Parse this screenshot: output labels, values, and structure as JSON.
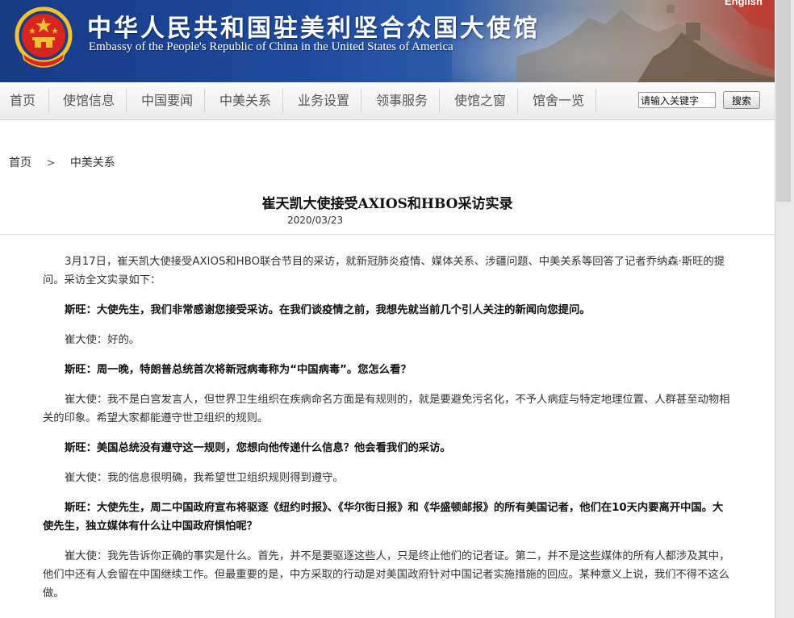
{
  "header": {
    "title_zh": "中华人民共和国驻美利坚合众国大使馆",
    "title_en": "Embassy of the People's Republic of China in the United States of America",
    "english_link": "English",
    "colors": {
      "banner_blue": "#1f4a9c",
      "emblem_red": "#d8261f",
      "emblem_gold": "#f2c230"
    }
  },
  "nav": {
    "items": [
      "首页",
      "使馆信息",
      "中国要闻",
      "中美关系",
      "业务设置",
      "领事服务",
      "使馆之窗",
      "馆舍一览"
    ]
  },
  "search": {
    "value": "请输入关键字",
    "button_label": "搜索"
  },
  "breadcrumb": {
    "items": [
      "首页",
      "中美关系"
    ]
  },
  "article": {
    "title": "崔天凯大使接受AXIOS和HBO采访实录",
    "date": "2020/03/23",
    "paragraphs": [
      {
        "bold": false,
        "text": "3月17日，崔天凯大使接受AXIOS和HBO联合节目的采访，就新冠肺炎疫情、媒体关系、涉疆问题、中美关系等回答了记者乔纳森·斯旺的提问。采访全文实录如下："
      },
      {
        "bold": true,
        "text": "斯旺：大使先生，我们非常感谢您接受采访。在我们谈疫情之前，我想先就当前几个引人关注的新闻向您提问。"
      },
      {
        "bold": false,
        "text": "崔大使：好的。"
      },
      {
        "bold": true,
        "text": "斯旺：周一晚，特朗普总统首次将新冠病毒称为“中国病毒”。您怎么看？"
      },
      {
        "bold": false,
        "text": "崔大使：我不是白宫发言人，但世界卫生组织在疾病命名方面是有规则的，就是要避免污名化，不予人病症与特定地理位置、人群甚至动物相关的印象。希望大家都能遵守世卫组织的规则。"
      },
      {
        "bold": true,
        "text": "斯旺：美国总统没有遵守这一规则，您想向他传递什么信息？他会看我们的采访。"
      },
      {
        "bold": false,
        "text": "崔大使：我的信息很明确，我希望世卫组织规则得到遵守。"
      },
      {
        "bold": true,
        "text": "斯旺：大使先生，周二中国政府宣布将驱逐《纽约时报》、《华尔街日报》和《华盛顿邮报》的所有美国记者，他们在10天内要离开中国。大使先生，独立媒体有什么让中国政府惧怕呢？"
      },
      {
        "bold": false,
        "text": "崔大使：我先告诉你正确的事实是什么。首先，并不是要驱逐这些人，只是终止他们的记者证。第二，并不是这些媒体的所有人都涉及其中，他们中还有人会留在中国继续工作。但最重要的是，中方采取的行动是对美国政府针对中国记者实施措施的回应。某种意义上说，我们不得不这么做。"
      }
    ]
  }
}
